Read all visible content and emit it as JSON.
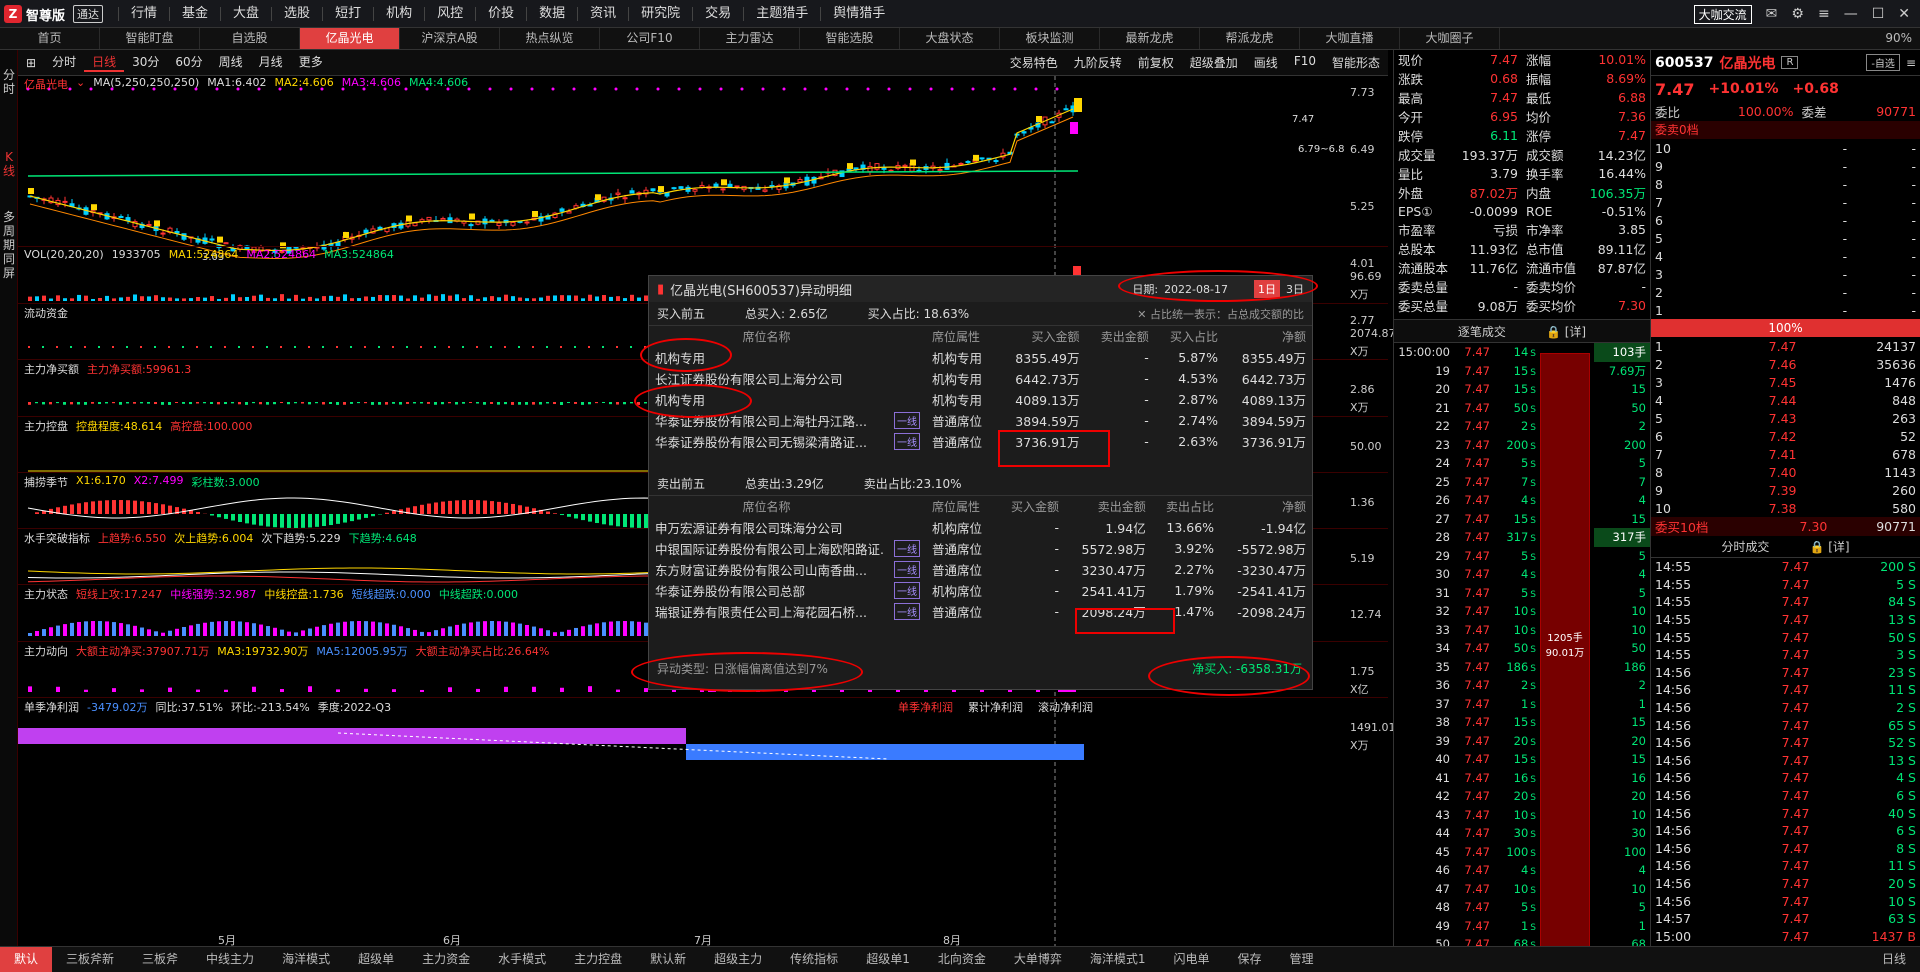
{
  "app": {
    "brand": "智尊版",
    "brand_badge": "通达"
  },
  "main_menu": [
    "行情",
    "基金",
    "大盘",
    "选股",
    "短打",
    "机构",
    "风控",
    "价投",
    "数据",
    "资讯",
    "研究院",
    "交易",
    "主题猎手",
    "舆情猎手"
  ],
  "window_controls": {
    "live_label": "大咖交流"
  },
  "tabs": [
    {
      "label": "首页"
    },
    {
      "label": "智能盯盘"
    },
    {
      "label": "自选股"
    },
    {
      "label": "亿晶光电",
      "active": true
    },
    {
      "label": "沪深京A股"
    },
    {
      "label": "热点纵览"
    },
    {
      "label": "公司F10"
    },
    {
      "label": "主力雷达"
    },
    {
      "label": "智能选股"
    },
    {
      "label": "大盘状态"
    },
    {
      "label": "板块监测"
    },
    {
      "label": "最新龙虎"
    },
    {
      "label": "帮派龙虎"
    },
    {
      "label": "大咖直播"
    },
    {
      "label": "大咖圈子"
    }
  ],
  "zoom": "90%",
  "left_tabs": [
    "分时",
    "K线",
    "多周期同屏"
  ],
  "chart_toolbar": {
    "periods": [
      "分时",
      "日线",
      "30分",
      "60分",
      "周线",
      "月线",
      "更多"
    ],
    "active": "日线",
    "right": [
      "交易特色",
      "九阶反转",
      "前复权",
      "超级叠加",
      "画线",
      "F10",
      "智能形态"
    ]
  },
  "k_panel": {
    "name": "亿晶光电",
    "ma_label": "MA(5,250,250,250)",
    "ma1": "MA1:6.402",
    "ma2": "MA2:4.606",
    "ma3": "MA3:4.606",
    "ma4": "MA4:4.606",
    "yaxis": [
      "7.73",
      "6.49",
      "5.25",
      "4.01",
      "2.77"
    ],
    "low_label": "3.03",
    "high_label": "7.47",
    "range_label": "6.79~6.8"
  },
  "panels": [
    {
      "id": "vol",
      "labels": [
        {
          "t": "VOL(20,20,20)",
          "c": "#ddd"
        },
        {
          "t": "1933705",
          "c": "#ddd"
        },
        {
          "t": "MA1:524864",
          "c": "#ffd700"
        },
        {
          "t": "MA2:524864",
          "c": "#ff00ff"
        },
        {
          "t": "MA3:524864",
          "c": "#00e676"
        }
      ],
      "yaxis": [
        "96.69",
        "X万"
      ]
    },
    {
      "id": "flow",
      "labels": [
        {
          "t": "流动资金",
          "c": "#ddd"
        }
      ],
      "yaxis": [
        "2074.87",
        "X万"
      ]
    },
    {
      "id": "netbuy",
      "labels": [
        {
          "t": "主力净买额",
          "c": "#ddd"
        },
        {
          "t": "主力净买额:59961.3",
          "c": "#ff3333"
        }
      ],
      "yaxis": [
        "2.86",
        "X万"
      ]
    },
    {
      "id": "ctrl",
      "labels": [
        {
          "t": "主力控盘",
          "c": "#ddd"
        },
        {
          "t": "控盘程度:48.614",
          "c": "#ffd700"
        },
        {
          "t": "高控盘:100.000",
          "c": "#ff3333"
        }
      ],
      "yaxis": [
        "50.00"
      ]
    },
    {
      "id": "season",
      "labels": [
        {
          "t": "捕捞季节",
          "c": "#ddd"
        },
        {
          "t": "X1:6.170",
          "c": "#ffd700"
        },
        {
          "t": "X2:7.499",
          "c": "#ff00ff"
        },
        {
          "t": "彩柱数:3.000",
          "c": "#00e676"
        }
      ],
      "yaxis": [
        "1.36"
      ]
    },
    {
      "id": "water",
      "labels": [
        {
          "t": "水手突破指标",
          "c": "#ddd"
        },
        {
          "t": "上趋势:6.550",
          "c": "#ff3333"
        },
        {
          "t": "次上趋势:6.004",
          "c": "#ffd700"
        },
        {
          "t": "次下趋势:5.229",
          "c": "#ddd"
        },
        {
          "t": "下趋势:4.648",
          "c": "#00e676"
        }
      ],
      "yaxis": [
        "5.19"
      ]
    },
    {
      "id": "state",
      "labels": [
        {
          "t": "主力状态",
          "c": "#ddd"
        },
        {
          "t": "短线上攻:17.247",
          "c": "#ff3333"
        },
        {
          "t": "中线强势:32.987",
          "c": "#ff00ff"
        },
        {
          "t": "中线控盘:1.736",
          "c": "#ffd700"
        },
        {
          "t": "短线超跌:0.000",
          "c": "#4a90ff"
        },
        {
          "t": "中线超跌:0.000",
          "c": "#00e676"
        }
      ],
      "right_title": "主力状态",
      "yaxis": [
        "12.74"
      ]
    },
    {
      "id": "motion",
      "labels": [
        {
          "t": "主力动向",
          "c": "#ddd"
        },
        {
          "t": "大额主动净买:37907.71万",
          "c": "#ff3333"
        },
        {
          "t": "MA3:19732.90万",
          "c": "#ffd700"
        },
        {
          "t": "MA5:12005.95万",
          "c": "#4a90ff"
        },
        {
          "t": "大额主动净买占比:26.64%",
          "c": "#ff3333"
        }
      ],
      "right_title": "主力动向",
      "yaxis": [
        "1.75",
        "X亿"
      ]
    },
    {
      "id": "profit",
      "labels": [
        {
          "t": "单季净利润",
          "c": "#ddd"
        },
        {
          "t": "-3479.02万",
          "c": "#4a90ff"
        },
        {
          "t": "同比:37.51%",
          "c": "#ddd"
        },
        {
          "t": "环比:-213.54%",
          "c": "#ddd"
        },
        {
          "t": "季度:2022-Q3",
          "c": "#ddd"
        }
      ],
      "right_tabs": [
        "单季净利润",
        "累计净利润",
        "滚动净利润"
      ],
      "yaxis": [
        "1491.01",
        "X万"
      ]
    }
  ],
  "x_axis": [
    "5月",
    "6月",
    "7月",
    "8月"
  ],
  "popup": {
    "title": "亿晶光电(SH600537)异动明细",
    "date_label": "日期:",
    "date": "2022-08-17",
    "btn1": "1日",
    "btn2": "3日",
    "buy": {
      "label": "买入前五",
      "total": "总买入: 2.65亿",
      "ratio": "买入占比: 18.63%",
      "note": "占比统一表示：占总成交额的比",
      "headers": [
        "席位名称",
        "席位属性",
        "买入金额",
        "卖出金额",
        "买入占比",
        "净额"
      ],
      "rows": [
        {
          "name": "机构专用",
          "type": "机构专用",
          "buy": "8355.49万",
          "sell": "-",
          "ratio": "5.87%",
          "net": "8355.49万",
          "tag": ""
        },
        {
          "name": "长江证券股份有限公司上海分公司",
          "type": "机构专用",
          "buy": "6442.73万",
          "sell": "-",
          "ratio": "4.53%",
          "net": "6442.73万",
          "tag": ""
        },
        {
          "name": "机构专用",
          "type": "机构专用",
          "buy": "4089.13万",
          "sell": "-",
          "ratio": "2.87%",
          "net": "4089.13万",
          "tag": ""
        },
        {
          "name": "华泰证券股份有限公司上海牡丹江路...",
          "type": "普通席位",
          "buy": "3894.59万",
          "sell": "-",
          "ratio": "2.74%",
          "net": "3894.59万",
          "tag": "一线"
        },
        {
          "name": "华泰证券股份有限公司无锡梁清路证...",
          "type": "普通席位",
          "buy": "3736.91万",
          "sell": "-",
          "ratio": "2.63%",
          "net": "3736.91万",
          "tag": "一线"
        }
      ]
    },
    "sell": {
      "label": "卖出前五",
      "total": "总卖出:3.29亿",
      "ratio": "卖出占比:23.10%",
      "headers": [
        "席位名称",
        "席位属性",
        "买入金额",
        "卖出金额",
        "卖出占比",
        "净额"
      ],
      "rows": [
        {
          "name": "申万宏源证券有限公司珠海分公司",
          "type": "机构席位",
          "buy": "-",
          "sell": "1.94亿",
          "ratio": "13.66%",
          "net": "-1.94亿",
          "tag": ""
        },
        {
          "name": "中银国际证券股份有限公司上海欧阳路证...",
          "type": "普通席位",
          "buy": "-",
          "sell": "5572.98万",
          "ratio": "3.92%",
          "net": "-5572.98万",
          "tag": "一线"
        },
        {
          "name": "东方财富证券股份有限公司山南香曲...",
          "type": "普通席位",
          "buy": "-",
          "sell": "3230.47万",
          "ratio": "2.27%",
          "net": "-3230.47万",
          "tag": "一线"
        },
        {
          "name": "华泰证券股份有限公司总部",
          "type": "机构席位",
          "buy": "-",
          "sell": "2541.41万",
          "ratio": "1.79%",
          "net": "-2541.41万",
          "tag": "一线"
        },
        {
          "name": "瑞银证券有限责任公司上海花园石桥...",
          "type": "普通席位",
          "buy": "-",
          "sell": "2098.24万",
          "ratio": "1.47%",
          "net": "-2098.24万",
          "tag": "一线"
        }
      ]
    },
    "anomaly": "异动类型: 日涨幅偏离值达到7%",
    "net": "净买入: -6358.31万"
  },
  "quote": {
    "rows": [
      [
        "现价",
        "7.47",
        "涨幅",
        "10.01%"
      ],
      [
        "涨跌",
        "0.68",
        "振幅",
        "8.69%"
      ],
      [
        "最高",
        "7.47",
        "最低",
        "6.88"
      ],
      [
        "今开",
        "6.95",
        "均价",
        "7.36"
      ],
      [
        "跌停",
        "6.11",
        "涨停",
        "7.47"
      ],
      [
        "成交量",
        "193.37万",
        "成交额",
        "14.23亿"
      ],
      [
        "量比",
        "3.79",
        "换手率",
        "16.44%"
      ],
      [
        "外盘",
        "87.02万",
        "内盘",
        "106.35万"
      ],
      [
        "EPS①",
        "-0.0099",
        "ROE",
        "-0.51%"
      ],
      [
        "市盈率",
        "亏损",
        "市净率",
        "3.85"
      ],
      [
        "总股本",
        "11.93亿",
        "总市值",
        "89.11亿"
      ],
      [
        "流通股本",
        "11.76亿",
        "流通市值",
        "87.87亿"
      ],
      [
        "委卖总量",
        "-",
        "委卖均价",
        "-"
      ],
      [
        "委买总量",
        "9.08万",
        "委买均价",
        "7.30"
      ]
    ],
    "ticks_title": "逐笔成交",
    "ticks_detail": "[详]",
    "ticks": [
      {
        "t": "15:00:00",
        "p": "7.47",
        "v": "14",
        "side": "S",
        "x": "14",
        "extra": "103手"
      },
      {
        "t": "19",
        "p": "7.47",
        "v": "15",
        "side": "S",
        "x": "",
        "extra": "7.69万"
      },
      {
        "t": "20",
        "p": "7.47",
        "v": "15",
        "side": "S",
        "x": "",
        "extra": "15"
      },
      {
        "t": "21",
        "p": "7.47",
        "v": "50",
        "side": "S",
        "x": "",
        "extra": "50"
      },
      {
        "t": "22",
        "p": "7.47",
        "v": "2",
        "side": "S",
        "x": "",
        "extra": "2"
      },
      {
        "t": "23",
        "p": "7.47",
        "v": "200",
        "side": "S",
        "x": "",
        "extra": "200"
      },
      {
        "t": "24",
        "p": "7.47",
        "v": "5",
        "side": "S",
        "x": "",
        "extra": "5"
      },
      {
        "t": "25",
        "p": "7.47",
        "v": "7",
        "side": "S",
        "x": "",
        "extra": "7"
      },
      {
        "t": "26",
        "p": "7.47",
        "v": "4",
        "side": "S",
        "x": "",
        "extra": "4"
      },
      {
        "t": "27",
        "p": "7.47",
        "v": "15",
        "side": "S",
        "x": "",
        "extra": "15"
      },
      {
        "t": "28",
        "p": "7.47",
        "v": "317",
        "side": "S",
        "x": "",
        "extra": "317手"
      },
      {
        "t": "29",
        "p": "7.47",
        "v": "5",
        "side": "S",
        "x": "",
        "extra": "5"
      },
      {
        "t": "30",
        "p": "7.47",
        "v": "4",
        "side": "S",
        "x": "",
        "extra": "4"
      },
      {
        "t": "31",
        "p": "7.47",
        "v": "5",
        "side": "S",
        "x": "",
        "extra": "5"
      },
      {
        "t": "32",
        "p": "7.47",
        "v": "10",
        "side": "S",
        "x": "",
        "extra": "10"
      },
      {
        "t": "33",
        "p": "7.47",
        "v": "10",
        "side": "S",
        "x": "",
        "extra": "10"
      },
      {
        "t": "34",
        "p": "7.47",
        "v": "50",
        "side": "S",
        "x": "",
        "extra": "50"
      },
      {
        "t": "35",
        "p": "7.47",
        "v": "186",
        "side": "S",
        "x": "",
        "extra": "186"
      },
      {
        "t": "36",
        "p": "7.47",
        "v": "2",
        "side": "S",
        "x": "",
        "extra": "2"
      },
      {
        "t": "37",
        "p": "7.47",
        "v": "1",
        "side": "S",
        "x": "",
        "extra": "1"
      },
      {
        "t": "38",
        "p": "7.47",
        "v": "15",
        "side": "S",
        "x": "",
        "extra": "15"
      },
      {
        "t": "39",
        "p": "7.47",
        "v": "20",
        "side": "S",
        "x": "",
        "extra": "20"
      },
      {
        "t": "40",
        "p": "7.47",
        "v": "15",
        "side": "S",
        "x": "",
        "extra": "15"
      },
      {
        "t": "41",
        "p": "7.47",
        "v": "16",
        "side": "S",
        "x": "",
        "extra": "16"
      },
      {
        "t": "42",
        "p": "7.47",
        "v": "20",
        "side": "S",
        "x": "",
        "extra": "20"
      },
      {
        "t": "43",
        "p": "7.47",
        "v": "10",
        "side": "S",
        "x": "",
        "extra": "10"
      },
      {
        "t": "44",
        "p": "7.47",
        "v": "30",
        "side": "S",
        "x": "",
        "extra": "30"
      },
      {
        "t": "45",
        "p": "7.47",
        "v": "100",
        "side": "S",
        "x": "",
        "extra": "100"
      },
      {
        "t": "46",
        "p": "7.47",
        "v": "4",
        "side": "S",
        "x": "",
        "extra": "4"
      },
      {
        "t": "47",
        "p": "7.47",
        "v": "10",
        "side": "S",
        "x": "",
        "extra": "10"
      },
      {
        "t": "48",
        "p": "7.47",
        "v": "5",
        "side": "S",
        "x": "",
        "extra": "5"
      },
      {
        "t": "49",
        "p": "7.47",
        "v": "1",
        "side": "S",
        "x": "",
        "extra": "1"
      },
      {
        "t": "50",
        "p": "7.47",
        "v": "68",
        "side": "S",
        "x": "",
        "extra": "68"
      }
    ],
    "bigbar": {
      "lots": "1205手",
      "amount": "90.01万"
    }
  },
  "book": {
    "code": "600537",
    "name": "亿晶光电",
    "self_btn": "-自选",
    "price": "7.47",
    "pct": "+10.01%",
    "chg": "+0.68",
    "wb_label": "委比",
    "wb": "100.00%",
    "wc_label": "委差",
    "wc": "90771",
    "sell_label": "委卖0档",
    "sell": [
      [
        "10",
        "-",
        "-"
      ],
      [
        "9",
        "-",
        "-"
      ],
      [
        "8",
        "-",
        "-"
      ],
      [
        "7",
        "-",
        "-"
      ],
      [
        "6",
        "-",
        "-"
      ],
      [
        "5",
        "-",
        "-"
      ],
      [
        "4",
        "-",
        "-"
      ],
      [
        "3",
        "-",
        "-"
      ],
      [
        "2",
        "-",
        "-"
      ],
      [
        "1",
        "-",
        "-"
      ]
    ],
    "pct_bar": "100%",
    "buy": [
      [
        "1",
        "7.47",
        "24137"
      ],
      [
        "2",
        "7.46",
        "35636"
      ],
      [
        "3",
        "7.45",
        "1476"
      ],
      [
        "4",
        "7.44",
        "848"
      ],
      [
        "5",
        "7.43",
        "263"
      ],
      [
        "6",
        "7.42",
        "52"
      ],
      [
        "7",
        "7.41",
        "678"
      ],
      [
        "8",
        "7.40",
        "1143"
      ],
      [
        "9",
        "7.39",
        "260"
      ],
      [
        "10",
        "7.38",
        "580"
      ]
    ],
    "buy_total_label": "委买10档",
    "buy_total_price": "7.30",
    "buy_total_vol": "90771",
    "ts_title": "分时成交",
    "ts_detail": "[详]",
    "ts": [
      [
        "14:55",
        "7.47",
        "200 S"
      ],
      [
        "14:55",
        "7.47",
        "5 S"
      ],
      [
        "14:55",
        "7.47",
        "84 S"
      ],
      [
        "14:55",
        "7.47",
        "13 S"
      ],
      [
        "14:55",
        "7.47",
        "50 S"
      ],
      [
        "14:55",
        "7.47",
        "3 S"
      ],
      [
        "14:56",
        "7.47",
        "23 S"
      ],
      [
        "14:56",
        "7.47",
        "11 S"
      ],
      [
        "14:56",
        "7.47",
        "2 S"
      ],
      [
        "14:56",
        "7.47",
        "65 S"
      ],
      [
        "14:56",
        "7.47",
        "52 S"
      ],
      [
        "14:56",
        "7.47",
        "13 S"
      ],
      [
        "14:56",
        "7.47",
        "4 S"
      ],
      [
        "14:56",
        "7.47",
        "6 S"
      ],
      [
        "14:56",
        "7.47",
        "40 S"
      ],
      [
        "14:56",
        "7.47",
        "6 S"
      ],
      [
        "14:56",
        "7.47",
        "8 S"
      ],
      [
        "14:56",
        "7.47",
        "11 S"
      ],
      [
        "14:56",
        "7.47",
        "20 S"
      ],
      [
        "14:56",
        "7.47",
        "10 S"
      ],
      [
        "14:57",
        "7.47",
        "63 S"
      ],
      [
        "15:00",
        "7.47",
        "1437 B"
      ]
    ]
  },
  "bottom_tabs": [
    "默认",
    "三板斧新",
    "三板斧",
    "中线主力",
    "海洋模式",
    "超级单",
    "主力资金",
    "水手模式",
    "主力控盘",
    "默认新",
    "超级主力",
    "传统指标",
    "超级单1",
    "北向资金",
    "大单博弈",
    "海洋模式1",
    "闪电单",
    "保存",
    "管理"
  ],
  "bottom_right": "日线"
}
